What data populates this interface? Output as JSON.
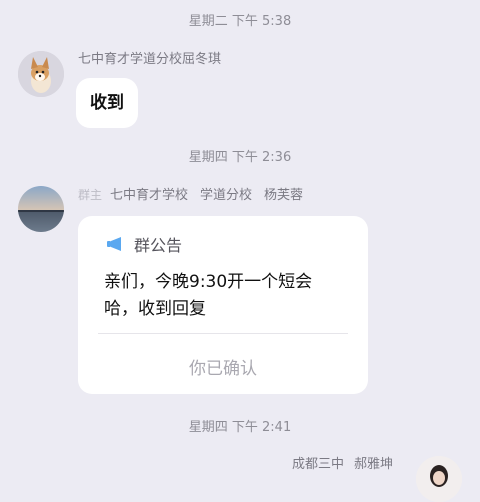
{
  "timestamps": [
    "星期二 下午 5:38",
    "星期四 下午 2:36",
    "星期四 下午 2:41"
  ],
  "messages": [
    {
      "sender": "七中育才学道分校屈冬琪",
      "text": "收到"
    },
    {
      "role": "群主",
      "sender_parts": [
        "七中育才学校",
        "学道分校",
        "杨芙蓉"
      ],
      "notice": {
        "title": "群公告",
        "body_lines": [
          "亲们，今晚9:30开一个短会",
          "哈，收到回复"
        ],
        "confirm": "你已确认"
      }
    },
    {
      "sender_parts": [
        "成都三中",
        "郝雅坤"
      ]
    }
  ],
  "colors": {
    "background": "#ecebf3",
    "bubble": "#ffffff",
    "megaphone": "#5aa8f0"
  },
  "icons": {
    "notice": "megaphone-icon"
  }
}
